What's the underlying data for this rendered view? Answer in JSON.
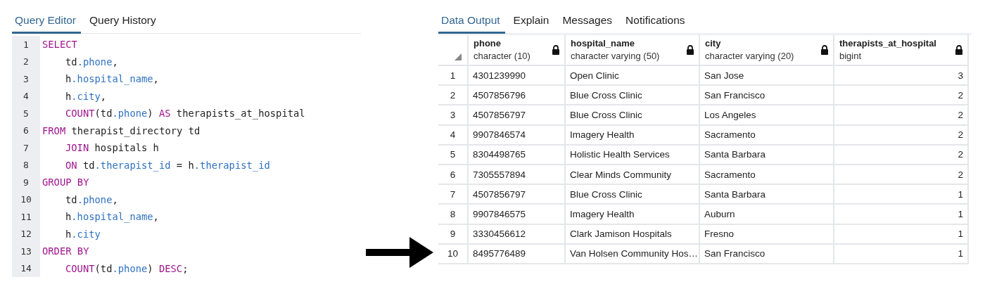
{
  "editor": {
    "tabs": [
      {
        "label": "Query Editor",
        "selected": true
      },
      {
        "label": "Query History",
        "selected": false
      }
    ],
    "lines": [
      {
        "number": "1",
        "indented": false,
        "tokens": [
          {
            "text": "SELECT",
            "kind": "keyword"
          }
        ]
      },
      {
        "number": "2",
        "indented": true,
        "tokens": [
          {
            "text": "td",
            "kind": "plain"
          },
          {
            "text": ".phone",
            "kind": "field"
          },
          {
            "text": ",",
            "kind": "plain"
          }
        ]
      },
      {
        "number": "3",
        "indented": true,
        "tokens": [
          {
            "text": "h",
            "kind": "plain"
          },
          {
            "text": ".hospital_name",
            "kind": "field"
          },
          {
            "text": ",",
            "kind": "plain"
          }
        ]
      },
      {
        "number": "4",
        "indented": true,
        "tokens": [
          {
            "text": "h",
            "kind": "plain"
          },
          {
            "text": ".city",
            "kind": "field"
          },
          {
            "text": ",",
            "kind": "plain"
          }
        ]
      },
      {
        "number": "5",
        "indented": true,
        "tokens": [
          {
            "text": "COUNT",
            "kind": "keyword"
          },
          {
            "text": "(td",
            "kind": "plain"
          },
          {
            "text": ".phone",
            "kind": "field"
          },
          {
            "text": ") ",
            "kind": "plain"
          },
          {
            "text": "AS",
            "kind": "keyword"
          },
          {
            "text": " therapists_at_hospital",
            "kind": "plain"
          }
        ]
      },
      {
        "number": "6",
        "indented": false,
        "tokens": [
          {
            "text": "FROM",
            "kind": "keyword"
          },
          {
            "text": " therapist_directory td",
            "kind": "plain"
          }
        ]
      },
      {
        "number": "7",
        "indented": true,
        "tokens": [
          {
            "text": "JOIN",
            "kind": "keyword"
          },
          {
            "text": " hospitals h",
            "kind": "plain"
          }
        ]
      },
      {
        "number": "8",
        "indented": true,
        "tokens": [
          {
            "text": "ON",
            "kind": "keyword"
          },
          {
            "text": " td",
            "kind": "plain"
          },
          {
            "text": ".therapist_id",
            "kind": "field"
          },
          {
            "text": " = h",
            "kind": "plain"
          },
          {
            "text": ".therapist_id",
            "kind": "field"
          }
        ]
      },
      {
        "number": "9",
        "indented": false,
        "tokens": [
          {
            "text": "GROUP BY",
            "kind": "keyword"
          }
        ]
      },
      {
        "number": "10",
        "indented": true,
        "tokens": [
          {
            "text": "td",
            "kind": "plain"
          },
          {
            "text": ".phone",
            "kind": "field"
          },
          {
            "text": ",",
            "kind": "plain"
          }
        ]
      },
      {
        "number": "11",
        "indented": true,
        "tokens": [
          {
            "text": "h",
            "kind": "plain"
          },
          {
            "text": ".hospital_name",
            "kind": "field"
          },
          {
            "text": ",",
            "kind": "plain"
          }
        ]
      },
      {
        "number": "12",
        "indented": true,
        "tokens": [
          {
            "text": "h",
            "kind": "plain"
          },
          {
            "text": ".city",
            "kind": "field"
          }
        ]
      },
      {
        "number": "13",
        "indented": false,
        "tokens": [
          {
            "text": "ORDER BY",
            "kind": "keyword"
          }
        ]
      },
      {
        "number": "14",
        "indented": true,
        "tokens": [
          {
            "text": "COUNT",
            "kind": "keyword"
          },
          {
            "text": "(td",
            "kind": "plain"
          },
          {
            "text": ".phone",
            "kind": "field"
          },
          {
            "text": ") ",
            "kind": "plain"
          },
          {
            "text": "DESC",
            "kind": "keyword"
          },
          {
            "text": ";",
            "kind": "plain"
          }
        ]
      }
    ]
  },
  "output": {
    "tabs": [
      {
        "label": "Data Output",
        "selected": true
      },
      {
        "label": "Explain",
        "selected": false
      },
      {
        "label": "Messages",
        "selected": false
      },
      {
        "label": "Notifications",
        "selected": false
      }
    ],
    "table": {
      "columns": [
        {
          "name": "phone",
          "type": "character (10)",
          "kind": "text"
        },
        {
          "name": "hospital_name",
          "type": "character varying (50)",
          "kind": "text"
        },
        {
          "name": "city",
          "type": "character varying (20)",
          "kind": "text"
        },
        {
          "name": "therapists_at_hospital",
          "type": "bigint",
          "kind": "number"
        }
      ],
      "rows": [
        {
          "number": "1",
          "cells": [
            "4301239990",
            "Open Clinic",
            "San Jose",
            "3"
          ]
        },
        {
          "number": "2",
          "cells": [
            "4507856796",
            "Blue Cross Clinic",
            "San Francisco",
            "2"
          ]
        },
        {
          "number": "3",
          "cells": [
            "4507856797",
            "Blue Cross Clinic",
            "Los Angeles",
            "2"
          ]
        },
        {
          "number": "4",
          "cells": [
            "9907846574",
            "Imagery Health",
            "Sacramento",
            "2"
          ]
        },
        {
          "number": "5",
          "cells": [
            "8304498765",
            "Holistic Health Services",
            "Santa Barbara",
            "2"
          ]
        },
        {
          "number": "6",
          "cells": [
            "7305557894",
            "Clear Minds Community",
            "Sacramento",
            "2"
          ]
        },
        {
          "number": "7",
          "cells": [
            "4507856797",
            "Blue Cross Clinic",
            "Santa Barbara",
            "1"
          ]
        },
        {
          "number": "8",
          "cells": [
            "9907846575",
            "Imagery Health",
            "Auburn",
            "1"
          ]
        },
        {
          "number": "9",
          "cells": [
            "3330456612",
            "Clark Jamison Hospitals",
            "Fresno",
            "1"
          ]
        },
        {
          "number": "10",
          "cells": [
            "8495776489",
            "Van Holsen Community Hos…",
            "San Francisco",
            "1"
          ]
        }
      ]
    }
  }
}
